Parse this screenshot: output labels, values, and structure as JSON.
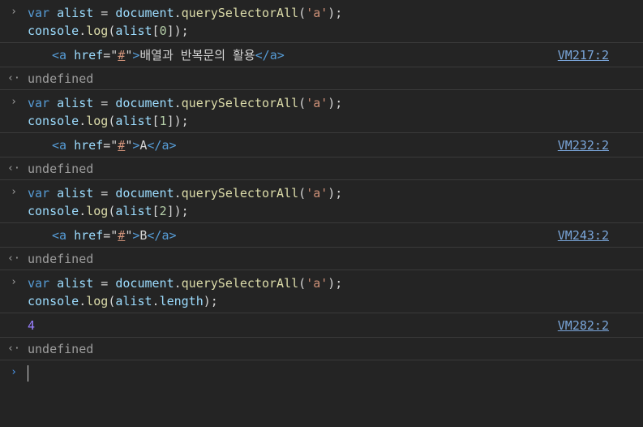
{
  "entries": [
    {
      "input": {
        "line1": {
          "kw": "var",
          "sp1": " ",
          "var": "alist",
          "eq": " = ",
          "obj": "document",
          "dot": ".",
          "fn": "querySelectorAll",
          "open": "(",
          "str": "'a'",
          "close": ");"
        },
        "line2": {
          "obj": "console",
          "dot": ".",
          "fn": "log",
          "open": "(",
          "var": "alist",
          "ob": "[",
          "idx": "0",
          "cb": "]",
          "close": ");"
        }
      },
      "output": {
        "lt": "<",
        "tag_open": "a",
        "sp": " ",
        "attr": "href",
        "eq": "=\"",
        "attr_val": "#",
        "q": "\"",
        "gt": ">",
        "text": "배열과 반복문의 활용",
        "close_tag": "</a>"
      },
      "source": "VM217:2",
      "result": "undefined"
    },
    {
      "input": {
        "line1": {
          "kw": "var",
          "sp1": " ",
          "var": "alist",
          "eq": " = ",
          "obj": "document",
          "dot": ".",
          "fn": "querySelectorAll",
          "open": "(",
          "str": "'a'",
          "close": ");"
        },
        "line2": {
          "obj": "console",
          "dot": ".",
          "fn": "log",
          "open": "(",
          "var": "alist",
          "ob": "[",
          "idx": "1",
          "cb": "]",
          "close": ");"
        }
      },
      "output": {
        "lt": "<",
        "tag_open": "a",
        "sp": " ",
        "attr": "href",
        "eq": "=\"",
        "attr_val": "#",
        "q": "\"",
        "gt": ">",
        "text": "A",
        "close_tag": "</a>"
      },
      "source": "VM232:2",
      "result": "undefined"
    },
    {
      "input": {
        "line1": {
          "kw": "var",
          "sp1": " ",
          "var": "alist",
          "eq": " = ",
          "obj": "document",
          "dot": ".",
          "fn": "querySelectorAll",
          "open": "(",
          "str": "'a'",
          "close": ");"
        },
        "line2": {
          "obj": "console",
          "dot": ".",
          "fn": "log",
          "open": "(",
          "var": "alist",
          "ob": "[",
          "idx": "2",
          "cb": "]",
          "close": ");"
        }
      },
      "output": {
        "lt": "<",
        "tag_open": "a",
        "sp": " ",
        "attr": "href",
        "eq": "=\"",
        "attr_val": "#",
        "q": "\"",
        "gt": ">",
        "text": "B",
        "close_tag": "</a>"
      },
      "source": "VM243:2",
      "result": "undefined"
    },
    {
      "input": {
        "line1": {
          "kw": "var",
          "sp1": " ",
          "var": "alist",
          "eq": " = ",
          "obj": "document",
          "dot": ".",
          "fn": "querySelectorAll",
          "open": "(",
          "str": "'a'",
          "close": ");"
        },
        "line2": {
          "obj": "console",
          "dot": ".",
          "fn": "log",
          "open": "(",
          "var": "alist",
          "prop_dot": ".",
          "prop": "length",
          "close": ");"
        }
      },
      "output_number": "4",
      "source": "VM282:2",
      "result": "undefined"
    }
  ],
  "icons": {
    "prompt": "›",
    "return": "‹·",
    "active_prompt": "›"
  },
  "colors": {
    "background": "#242424",
    "keyword": "#569cd6",
    "variable": "#9cdcfe",
    "function": "#dcdcaa",
    "string": "#ce9178",
    "number_output": "#9980ff",
    "link": "#7aa6da",
    "prompt_active": "#4d9cf5"
  }
}
